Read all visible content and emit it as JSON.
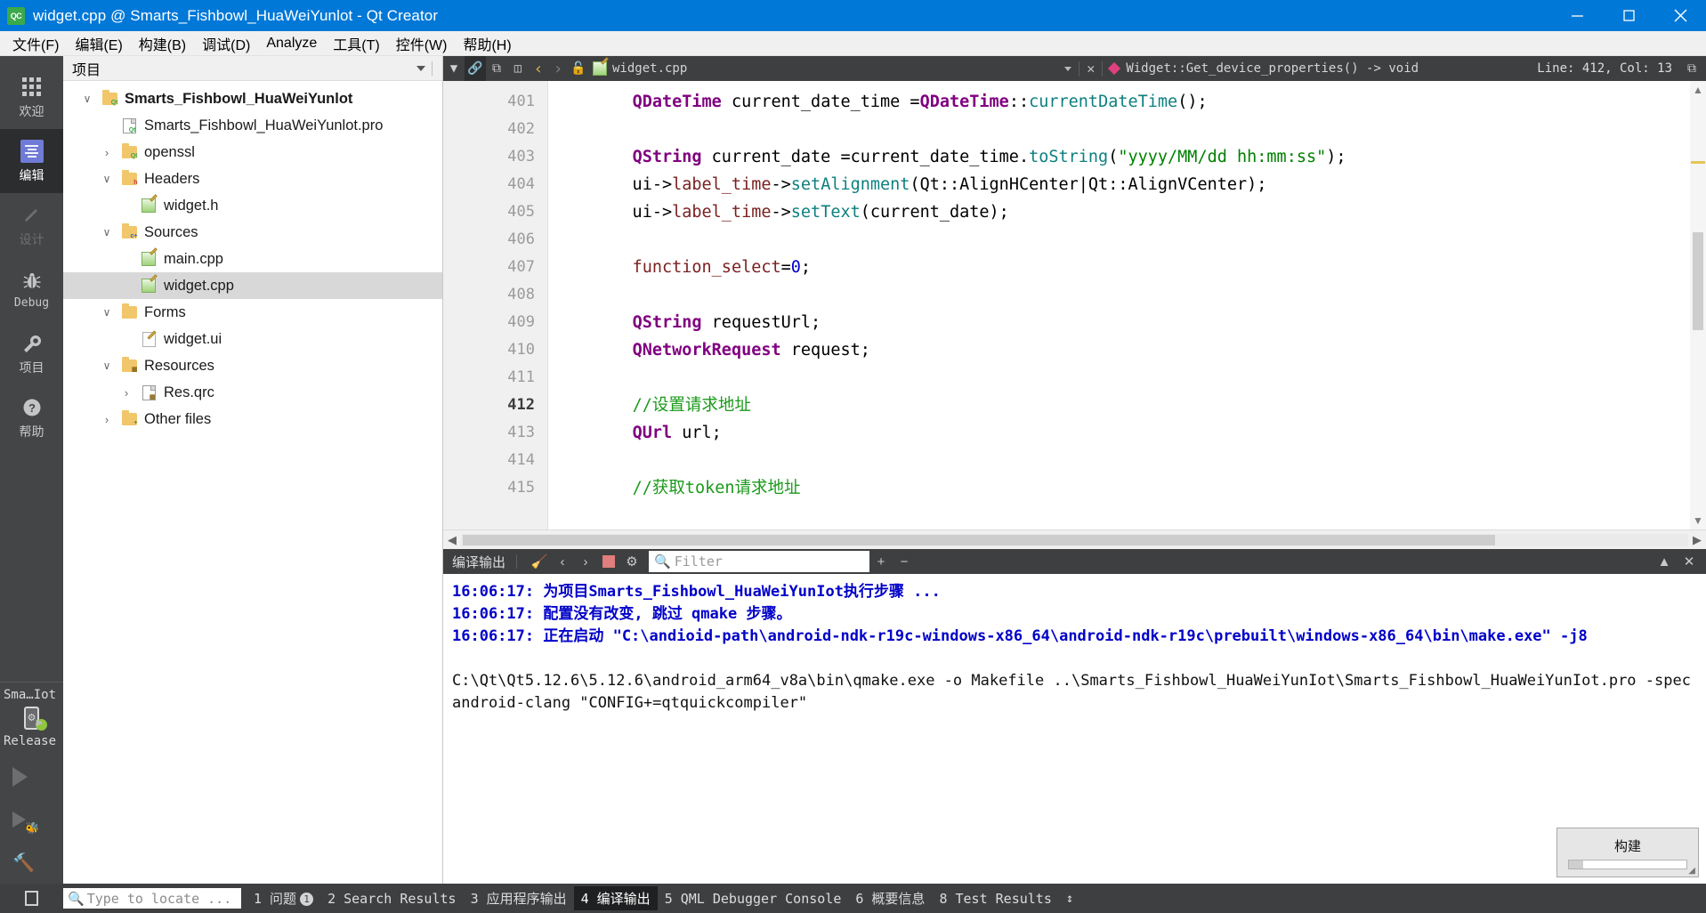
{
  "window": {
    "title": "widget.cpp @ Smarts_Fishbowl_HuaWeiYunlot - Qt Creator",
    "app_badge": "QC",
    "minimize": "minimize-button",
    "maximize": "maximize-button",
    "close": "close-button"
  },
  "menubar": {
    "items": [
      {
        "label": "文件(F)"
      },
      {
        "label": "编辑(E)"
      },
      {
        "label": "构建(B)"
      },
      {
        "label": "调试(D)"
      },
      {
        "label": "Analyze"
      },
      {
        "label": "工具(T)"
      },
      {
        "label": "控件(W)"
      },
      {
        "label": "帮助(H)"
      }
    ]
  },
  "modebar": {
    "modes": [
      {
        "label": "欢迎",
        "icon": "grid-icon",
        "state": "normal"
      },
      {
        "label": "编辑",
        "icon": "edit-icon",
        "state": "active"
      },
      {
        "label": "设计",
        "icon": "pencil-icon",
        "state": "disabled"
      },
      {
        "label": "Debug",
        "icon": "bug-icon",
        "state": "normal"
      },
      {
        "label": "项目",
        "icon": "wrench-icon",
        "state": "normal"
      },
      {
        "label": "帮助",
        "icon": "question-icon",
        "state": "normal"
      }
    ],
    "kit": {
      "project": "Sma…Iot",
      "build_config": "Release",
      "device_icon": "android-phone-icon",
      "status_dot_color": "#8ec63f"
    },
    "actions": [
      {
        "name": "run-button",
        "icon": "play-icon"
      },
      {
        "name": "debug-button",
        "icon": "play-bug-icon"
      },
      {
        "name": "build-button",
        "icon": "hammer-icon"
      }
    ]
  },
  "project_panel": {
    "header_title": "项目",
    "tree": [
      {
        "indent": 0,
        "expander": "down",
        "icon": "qt-project-folder-icon",
        "label": "Smarts_Fishbowl_HuaWeiYunlot",
        "bold": true,
        "selected": false
      },
      {
        "indent": 1,
        "expander": "none",
        "icon": "qt-pro-file-icon",
        "label": "Smarts_Fishbowl_HuaWeiYunlot.pro",
        "bold": false,
        "selected": false
      },
      {
        "indent": 1,
        "expander": "right",
        "icon": "qt-project-folder-icon",
        "label": "openssl",
        "bold": false,
        "selected": false
      },
      {
        "indent": 1,
        "expander": "down",
        "icon": "headers-folder-icon",
        "label": "Headers",
        "bold": false,
        "selected": false
      },
      {
        "indent": 2,
        "expander": "none",
        "icon": "source-file-icon",
        "label": "widget.h",
        "bold": false,
        "selected": false
      },
      {
        "indent": 1,
        "expander": "down",
        "icon": "sources-folder-icon",
        "label": "Sources",
        "bold": false,
        "selected": false
      },
      {
        "indent": 2,
        "expander": "none",
        "icon": "source-file-icon",
        "label": "main.cpp",
        "bold": false,
        "selected": false
      },
      {
        "indent": 2,
        "expander": "none",
        "icon": "source-file-icon",
        "label": "widget.cpp",
        "bold": false,
        "selected": true
      },
      {
        "indent": 1,
        "expander": "down",
        "icon": "forms-folder-icon",
        "label": "Forms",
        "bold": false,
        "selected": false
      },
      {
        "indent": 2,
        "expander": "none",
        "icon": "ui-file-icon",
        "label": "widget.ui",
        "bold": false,
        "selected": false
      },
      {
        "indent": 1,
        "expander": "down",
        "icon": "resources-folder-icon",
        "label": "Resources",
        "bold": false,
        "selected": false
      },
      {
        "indent": 2,
        "expander": "right",
        "icon": "qrc-file-icon",
        "label": "Res.qrc",
        "bold": false,
        "selected": false
      },
      {
        "indent": 1,
        "expander": "right",
        "icon": "other-folder-icon",
        "label": "Other files",
        "bold": false,
        "selected": false
      }
    ]
  },
  "editor": {
    "toolbar": {
      "filter_icon": "filter-icon",
      "link_icon": "link-editors-icon",
      "split_icon": "split-editor-icon",
      "fullscreen_icon": "maximize-pane-icon",
      "nav_back": "‹",
      "nav_forward": "›",
      "lock_icon": "unlocked-icon",
      "file_icon": "source-file-icon",
      "file_name": "widget.cpp",
      "close_label": "✕",
      "symbol_icon": "function-symbol-icon",
      "symbol_name": "Widget::Get_device_properties() -> void",
      "line_col": "Line: 412, Col: 13",
      "split_right_icon": "split-icon"
    },
    "first_line_number": 401,
    "current_line": 412,
    "lines": [
      {
        "n": 401,
        "tokens": [
          {
            "t": "    ",
            "c": "pl"
          },
          {
            "t": "QDateTime",
            "c": "type"
          },
          {
            "t": " current_date_time =",
            "c": "pl"
          },
          {
            "t": "QDateTime",
            "c": "type"
          },
          {
            "t": "::",
            "c": "pl"
          },
          {
            "t": "currentDateTime",
            "c": "fn"
          },
          {
            "t": "();",
            "c": "pl"
          }
        ]
      },
      {
        "n": 402,
        "tokens": []
      },
      {
        "n": 403,
        "tokens": [
          {
            "t": "    ",
            "c": "pl"
          },
          {
            "t": "QString",
            "c": "type"
          },
          {
            "t": " current_date =current_date_time.",
            "c": "pl"
          },
          {
            "t": "toString",
            "c": "fn"
          },
          {
            "t": "(",
            "c": "pl"
          },
          {
            "t": "\"yyyy/MM/dd hh:mm:ss\"",
            "c": "str"
          },
          {
            "t": ");",
            "c": "pl"
          }
        ]
      },
      {
        "n": 404,
        "tokens": [
          {
            "t": "    ui->",
            "c": "pl"
          },
          {
            "t": "label_time",
            "c": "mem"
          },
          {
            "t": "->",
            "c": "pl"
          },
          {
            "t": "setAlignment",
            "c": "fn"
          },
          {
            "t": "(Qt::AlignHCenter|Qt::AlignVCenter);",
            "c": "pl"
          }
        ]
      },
      {
        "n": 405,
        "tokens": [
          {
            "t": "    ui->",
            "c": "pl"
          },
          {
            "t": "label_time",
            "c": "mem"
          },
          {
            "t": "->",
            "c": "pl"
          },
          {
            "t": "setText",
            "c": "fn"
          },
          {
            "t": "(current_date);",
            "c": "pl"
          }
        ]
      },
      {
        "n": 406,
        "tokens": []
      },
      {
        "n": 407,
        "tokens": [
          {
            "t": "    ",
            "c": "pl"
          },
          {
            "t": "function_select",
            "c": "mem"
          },
          {
            "t": "=",
            "c": "pl"
          },
          {
            "t": "0",
            "c": "num"
          },
          {
            "t": ";",
            "c": "pl"
          }
        ]
      },
      {
        "n": 408,
        "tokens": []
      },
      {
        "n": 409,
        "tokens": [
          {
            "t": "    ",
            "c": "pl"
          },
          {
            "t": "QString",
            "c": "type"
          },
          {
            "t": " requestUrl;",
            "c": "pl"
          }
        ]
      },
      {
        "n": 410,
        "tokens": [
          {
            "t": "    ",
            "c": "pl"
          },
          {
            "t": "QNetworkRequest",
            "c": "type"
          },
          {
            "t": " request;",
            "c": "pl"
          }
        ]
      },
      {
        "n": 411,
        "tokens": []
      },
      {
        "n": 412,
        "tokens": [
          {
            "t": "    ",
            "c": "pl"
          },
          {
            "t": "//设置请求地址",
            "c": "cmt"
          }
        ]
      },
      {
        "n": 413,
        "tokens": [
          {
            "t": "    ",
            "c": "pl"
          },
          {
            "t": "QUrl",
            "c": "type"
          },
          {
            "t": " url;",
            "c": "pl"
          }
        ]
      },
      {
        "n": 414,
        "tokens": []
      },
      {
        "n": 415,
        "tokens": [
          {
            "t": "    ",
            "c": "pl"
          },
          {
            "t": "//获取token请求地址",
            "c": "cmt"
          }
        ]
      }
    ]
  },
  "output_pane": {
    "title": "编译输出",
    "buttons": [
      {
        "name": "clear-output-button",
        "icon": "broom-icon"
      },
      {
        "name": "prev-item-button",
        "icon": "chevron-left-icon"
      },
      {
        "name": "next-item-button",
        "icon": "chevron-right-icon"
      },
      {
        "name": "stop-button",
        "icon": "stop-square-icon"
      },
      {
        "name": "settings-button",
        "icon": "gear-icon"
      }
    ],
    "filter_placeholder": "Filter",
    "zoom_in": "+",
    "zoom_out": "−",
    "maximize_icon": "chevron-up-icon",
    "close_icon": "close-icon",
    "lines": [
      {
        "style": "blue",
        "text": "16:06:17: 为项目Smarts_Fishbowl_HuaWeiYunIot执行步骤 ..."
      },
      {
        "style": "blue",
        "text": "16:06:17: 配置没有改变, 跳过 qmake 步骤。"
      },
      {
        "style": "blue",
        "text": "16:06:17: 正在启动 \"C:\\andioid-path\\android-ndk-r19c-windows-x86_64\\android-ndk-r19c\\prebuilt\\windows-x86_64\\bin\\make.exe\" -j8"
      },
      {
        "style": "blank",
        "text": ""
      },
      {
        "style": "plain",
        "text": "C:\\Qt\\Qt5.12.6\\5.12.6\\android_arm64_v8a\\bin\\qmake.exe -o Makefile ..\\Smarts_Fishbowl_HuaWeiYunIot\\Smarts_Fishbowl_HuaWeiYunIot.pro -spec android-clang \"CONFIG+=qtquickcompiler\""
      }
    ]
  },
  "statusbar": {
    "locator_placeholder": "Type to locate ...",
    "panes": [
      {
        "label": "1 问题",
        "badge": "1",
        "active": false
      },
      {
        "label": "2 Search Results",
        "badge": "",
        "active": false
      },
      {
        "label": "3 应用程序输出",
        "badge": "",
        "active": false
      },
      {
        "label": "4 编译输出",
        "badge": "",
        "active": true
      },
      {
        "label": "5 QML Debugger Console",
        "badge": "",
        "active": false
      },
      {
        "label": "6 概要信息",
        "badge": "",
        "active": false
      },
      {
        "label": "8 Test Results",
        "badge": "",
        "active": false
      }
    ],
    "updown_icon": "updown-arrows-icon"
  },
  "progress": {
    "label": "构建",
    "percent": 12
  }
}
